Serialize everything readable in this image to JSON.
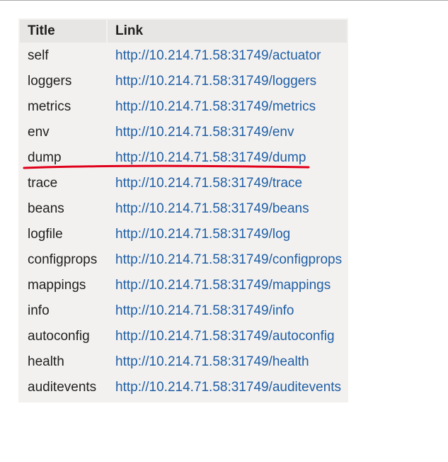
{
  "table": {
    "headers": {
      "title": "Title",
      "link": "Link"
    },
    "rows": [
      {
        "title": "self",
        "link": "http://10.214.71.58:31749/actuator"
      },
      {
        "title": "loggers",
        "link": "http://10.214.71.58:31749/loggers"
      },
      {
        "title": "metrics",
        "link": "http://10.214.71.58:31749/metrics"
      },
      {
        "title": "env",
        "link": "http://10.214.71.58:31749/env"
      },
      {
        "title": "dump",
        "link": "http://10.214.71.58:31749/dump"
      },
      {
        "title": "trace",
        "link": "http://10.214.71.58:31749/trace"
      },
      {
        "title": "beans",
        "link": "http://10.214.71.58:31749/beans"
      },
      {
        "title": "logfile",
        "link": "http://10.214.71.58:31749/log"
      },
      {
        "title": "configprops",
        "link": "http://10.214.71.58:31749/configprops"
      },
      {
        "title": "mappings",
        "link": "http://10.214.71.58:31749/mappings"
      },
      {
        "title": "info",
        "link": "http://10.214.71.58:31749/info"
      },
      {
        "title": "autoconfig",
        "link": "http://10.214.71.58:31749/autoconfig"
      },
      {
        "title": "health",
        "link": "http://10.214.71.58:31749/health"
      },
      {
        "title": "auditevents",
        "link": "http://10.214.71.58:31749/auditevents"
      }
    ]
  },
  "annotation": {
    "color": "#e0001b",
    "marks_row": "dump"
  },
  "colors": {
    "link": "#1f5fa6",
    "table_bg": "#f3f1ef",
    "header_bg": "#e8e6e4"
  }
}
